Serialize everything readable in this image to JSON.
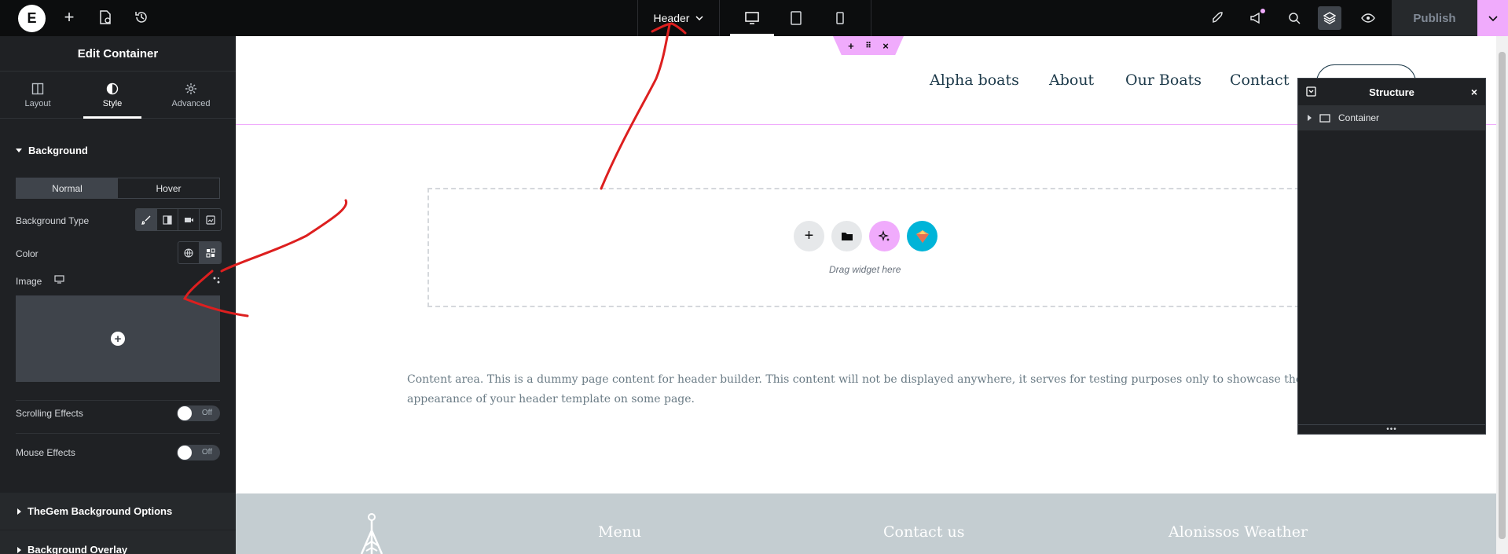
{
  "topbar": {
    "logo_glyph": "E",
    "document_title": "Header",
    "publish_label": "Publish"
  },
  "panel": {
    "title": "Edit Container",
    "tabs": [
      {
        "label": "Layout",
        "icon": "layout-icon"
      },
      {
        "label": "Style",
        "icon": "contrast-icon",
        "active": true
      },
      {
        "label": "Advanced",
        "icon": "gear-icon"
      }
    ],
    "background": {
      "title": "Background",
      "normal_label": "Normal",
      "hover_label": "Hover",
      "type_label": "Background Type",
      "color_label": "Color",
      "image_label": "Image"
    },
    "scrolling_effects": {
      "label": "Scrolling Effects",
      "state": "Off"
    },
    "mouse_effects": {
      "label": "Mouse Effects",
      "state": "Off"
    },
    "sections": [
      "TheGem Background Options",
      "Background Overlay"
    ]
  },
  "canvas": {
    "nav": [
      "Alpha boats",
      "About",
      "Our Boats",
      "Contact"
    ],
    "drag_text": "Drag widget here",
    "content_text": "Content area. This is a dummy page content for header builder. This content will not be displayed anywhere, it serves for testing purposes only to showcase the appearance of your header template on some page.",
    "footer_titles": [
      "Menu",
      "Contact us",
      "Alonissos Weather"
    ]
  },
  "structure": {
    "title": "Structure",
    "items": [
      "Container"
    ]
  },
  "colors": {
    "accent": "#f0abfc",
    "panel_bg": "#1f2124",
    "topbar_bg": "#0c0d0e",
    "annotation": "#dd1f1f"
  }
}
